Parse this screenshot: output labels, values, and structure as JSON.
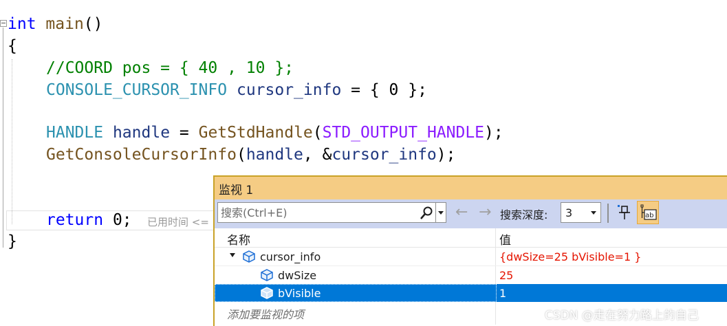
{
  "code": {
    "line1": {
      "kw": "int",
      "fn": "main",
      "rest": "()"
    },
    "line2": "{",
    "line3": "//COORD pos = { 40 , 10 };",
    "line4": {
      "type": "CONSOLE_CURSOR_INFO",
      "var": "cursor_info",
      "rest": " = { 0 };"
    },
    "line5": {
      "type": "HANDLE",
      "var": "handle",
      "eq": " = ",
      "fn": "GetStdHandle",
      "open": "(",
      "macro": "STD_OUTPUT_HANDLE",
      "close": ");"
    },
    "line6": {
      "fn": "GetConsoleCursorInfo",
      "open": "(",
      "arg1": "handle",
      "mid": ", &",
      "arg2": "cursor_info",
      "close": ");"
    },
    "line7": {
      "kw": "return",
      "num": " 0",
      "semi": ";"
    },
    "line8": "}",
    "elapsed_hint": "已用时间 <="
  },
  "watch": {
    "title": "监视 1",
    "search_placeholder": "搜索(Ctrl+E)",
    "back_arrow": "←",
    "forward_arrow": "→",
    "depth_label": "搜索深度:",
    "depth_value": "3",
    "columns": {
      "name": "名称",
      "value": "值"
    },
    "rows": [
      {
        "name": "cursor_info",
        "value": "{dwSize=25 bVisible=1 }",
        "expanded": true,
        "level": 0
      },
      {
        "name": "dwSize",
        "value": "25",
        "level": 1
      },
      {
        "name": "bVisible",
        "value": "1",
        "level": 1,
        "selected": true
      }
    ],
    "add_placeholder": "添加要监视的项"
  },
  "watermark": "CSDN @走在努力路上的自己"
}
